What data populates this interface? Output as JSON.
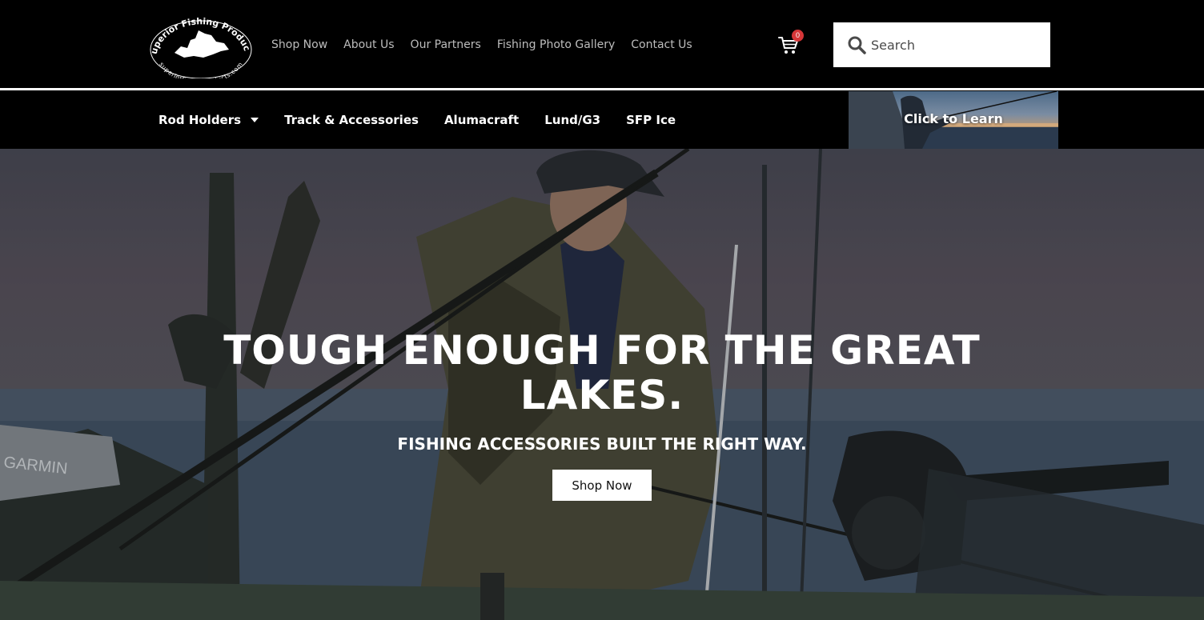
{
  "brand": {
    "logo_text_top": "Superior Fishing Products",
    "logo_text_bottom": "superiorfishingproducts.com"
  },
  "top_nav": {
    "items": [
      {
        "label": "Shop Now"
      },
      {
        "label": "About Us"
      },
      {
        "label": "Our Partners"
      },
      {
        "label": "Fishing Photo Gallery"
      },
      {
        "label": "Contact Us"
      }
    ]
  },
  "cart": {
    "count": "0",
    "icon": "cart-icon",
    "badge_color": "#d63638"
  },
  "search": {
    "placeholder": "Search",
    "icon": "search-icon"
  },
  "sub_nav": {
    "items": [
      {
        "label": "Rod Holders",
        "has_dropdown": true
      },
      {
        "label": "Track & Accessories"
      },
      {
        "label": "Alumacraft"
      },
      {
        "label": "Lund/G3"
      },
      {
        "label": "SFP Ice"
      }
    ]
  },
  "promo": {
    "label": "Click to Learn"
  },
  "hero": {
    "title": "TOUGH ENOUGH FOR THE GREAT LAKES.",
    "subtitle": "FISHING ACCESSORIES BUILT THE RIGHT WAY.",
    "cta_label": "Shop Now",
    "boat_brand_text": "GARMIN"
  },
  "colors": {
    "header_bg": "#000000",
    "nav_text": "#bdbdbd",
    "accent_white": "#ffffff"
  }
}
